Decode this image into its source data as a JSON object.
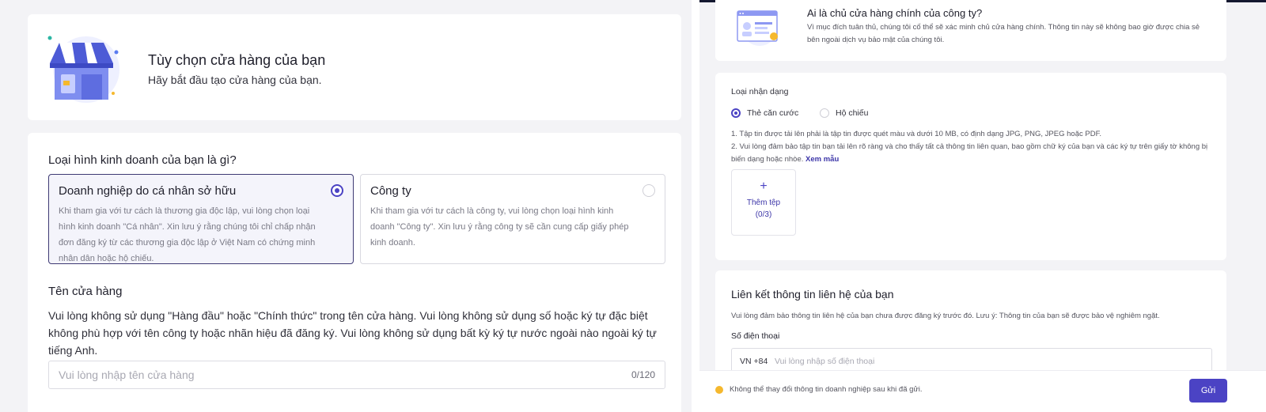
{
  "left": {
    "header": {
      "title": "Tùy chọn cửa hàng của bạn",
      "subtitle": "Hãy bắt đầu tạo cửa hàng của bạn."
    },
    "business_type": {
      "question": "Loại hình kinh doanh của bạn là gì?",
      "options": [
        {
          "title": "Doanh nghiệp do cá nhân sở hữu",
          "description": "Khi tham gia với tư cách là thương gia độc lập, vui lòng chọn loại hình kinh doanh \"Cá nhân\". Xin lưu ý rằng chúng tôi chỉ chấp nhận đơn đăng ký từ các thương gia độc lập ở Việt Nam có chứng minh nhân dân hoặc hộ chiếu.",
          "selected": true
        },
        {
          "title": "Công ty",
          "description": "Khi tham gia với tư cách là công ty, vui lòng chọn loại hình kinh doanh \"Công ty\". Xin lưu ý rằng công ty sẽ cần cung cấp giấy phép kinh doanh.",
          "selected": false
        }
      ]
    },
    "shop_name": {
      "label": "Tên cửa hàng",
      "help": "Vui lòng không sử dụng \"Hàng đầu\" hoặc \"Chính thức\" trong tên cửa hàng. Vui lòng không sử dụng số hoặc ký tự đặc biệt không phù hợp với tên công ty hoặc nhãn hiệu đã đăng ký. Vui lòng không sử dụng bất kỳ ký tự nước ngoài nào ngoài ký tự tiếng Anh.",
      "placeholder": "Vui lòng nhập tên cửa hàng",
      "value": "",
      "counter": "0/120"
    }
  },
  "right": {
    "owner": {
      "title": "Ai là chủ cửa hàng chính của công ty?",
      "description": "Vì mục đích tuân thủ, chúng tôi cố thể sẽ xác minh chủ cửa hàng chính. Thông tin này sẽ không bao giờ được chia sẻ bên ngoài dịch vụ bảo mật của chúng tôi."
    },
    "id_type": {
      "label": "Loại nhận dạng",
      "options": [
        {
          "label": "Thẻ căn cước",
          "selected": true
        },
        {
          "label": "Hộ chiếu",
          "selected": false
        }
      ],
      "note_1": "1. Tập tin được tải lên phải là tập tin được quét màu và dưới 10 MB, có định dạng JPG, PNG, JPEG hoặc PDF.",
      "note_2": "2. Vui lòng đảm bảo tập tin bạn tải lên rõ ràng và cho thấy tất cả thông tin liên quan, bao gồm chữ ký của bạn và các ký tự trên giấy tờ không bị biến dạng hoặc nhòe.",
      "sample_link": "Xem mẫu",
      "upload_label": "Thêm tệp",
      "upload_count": "(0/3)"
    },
    "contact": {
      "title": "Liên kết thông tin liên hệ của bạn",
      "description": "Vui lòng đảm bảo thông tin liên hệ của bạn chưa được đăng ký trước đó. Lưu ý: Thông tin của bạn sẽ được bảo vệ nghiêm ngặt.",
      "phone_label": "Số điện thoại",
      "country_code": "VN +84",
      "phone_placeholder": "Vui lòng nhập số điện thoại",
      "phone_value": ""
    },
    "footer": {
      "warning": "Không thể thay đổi thông tin doanh nghiệp sau khi đã gửi.",
      "submit_label": "Gửi"
    }
  },
  "colors": {
    "accent": "#4b43c4",
    "background": "#f3f3f6",
    "warning": "#f5b82e",
    "top_bar": "#141830"
  }
}
